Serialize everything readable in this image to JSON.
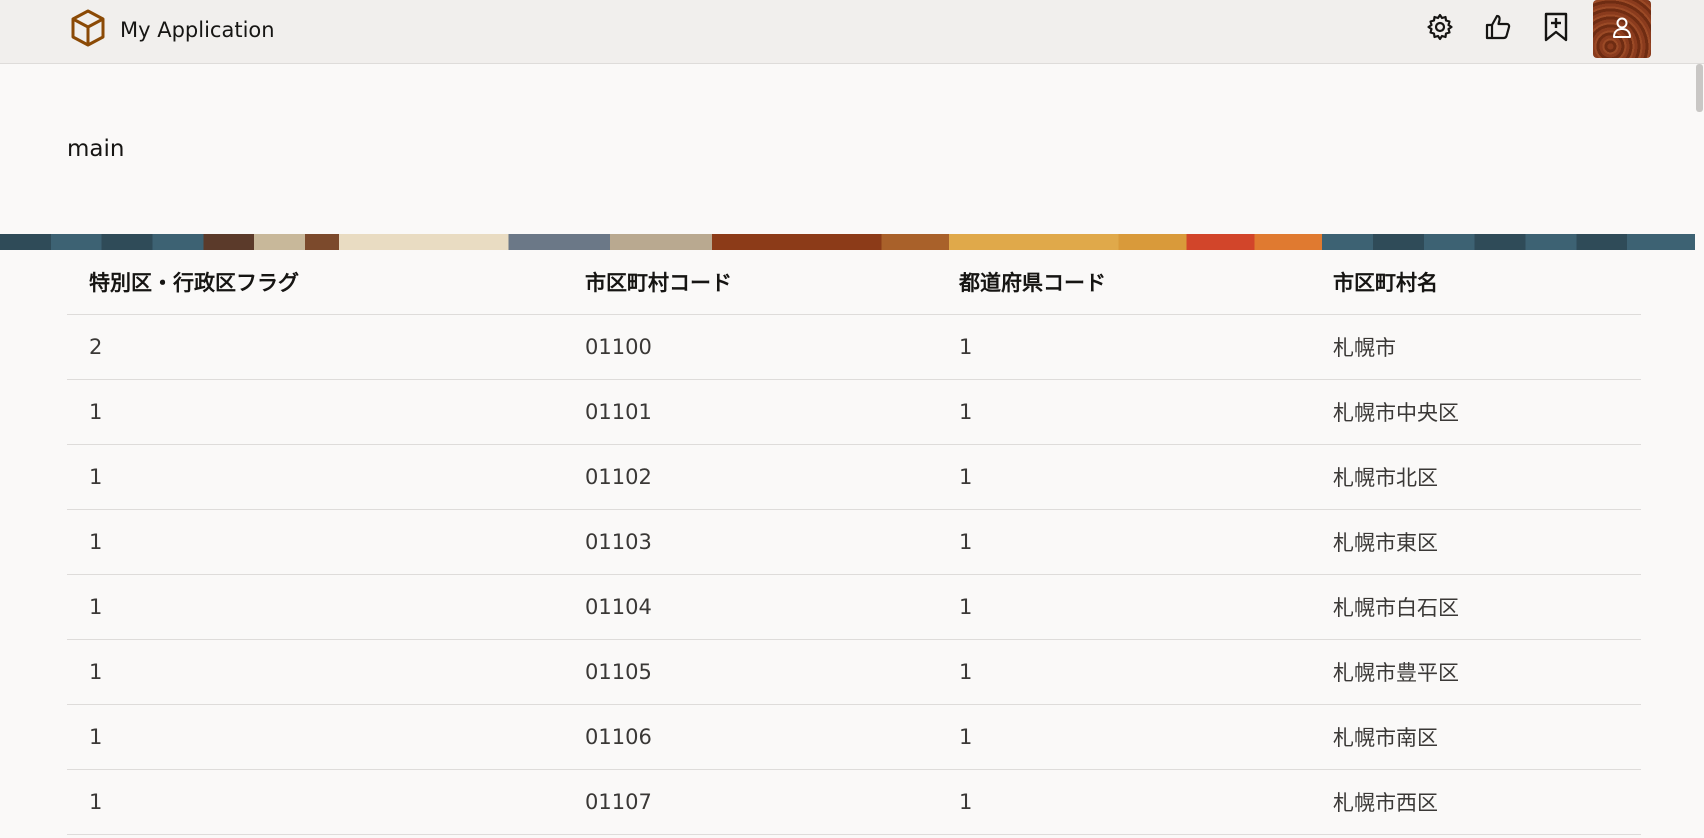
{
  "app": {
    "title": "My Application"
  },
  "icons": {
    "logo": "cube-icon",
    "settings": "gear-icon",
    "like": "thumbs-up-icon",
    "bookmark": "bookmark-add-icon",
    "user": "user-icon",
    "accent": "#8b4a06"
  },
  "page": {
    "heading": "main"
  },
  "table": {
    "headers": [
      "特別区・行政区フラグ",
      "市区町村コード",
      "都道府県コード",
      "市区町村名"
    ],
    "rows": [
      [
        "2",
        "01100",
        "1",
        "札幌市"
      ],
      [
        "1",
        "01101",
        "1",
        "札幌市中央区"
      ],
      [
        "1",
        "01102",
        "1",
        "札幌市北区"
      ],
      [
        "1",
        "01103",
        "1",
        "札幌市東区"
      ],
      [
        "1",
        "01104",
        "1",
        "札幌市白石区"
      ],
      [
        "1",
        "01105",
        "1",
        "札幌市豊平区"
      ],
      [
        "1",
        "01106",
        "1",
        "札幌市南区"
      ],
      [
        "1",
        "01107",
        "1",
        "札幌市西区"
      ]
    ]
  }
}
